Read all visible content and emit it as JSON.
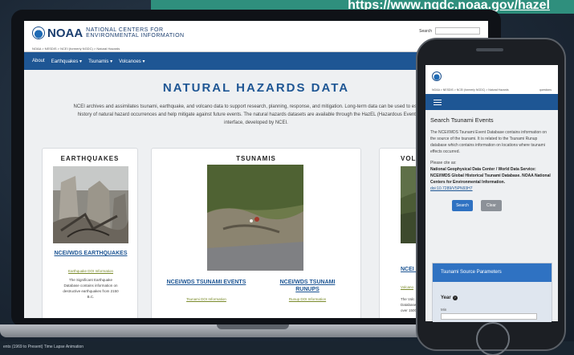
{
  "banner": {
    "url": "https://www.ngdc.noaa.gov/hazel"
  },
  "laptop": {
    "logo_text": "NOAA",
    "org_line1": "NATIONAL CENTERS FOR",
    "org_line2": "ENVIRONMENTAL INFORMATION",
    "search_label": "Search",
    "breadcrumb": "NOAA > NESDIS > NCEI (formerly NGDC) > Natural Hazards",
    "nav": [
      "About",
      "Earthquakes ▾",
      "Tsunamis ▾",
      "Volcanoes ▾"
    ],
    "page_title": "NATURAL HAZARDS DATA",
    "intro": "NCEI archives and assimilates tsunami, earthquake, and volcano data to support research, planning, response, and mitigation. Long-term data can be used to establish the history of natural hazard occurrences and help mitigate against future events. The natural hazards datasets are available through the HazEL (Hazardous Event Lookup) interface, developed by NCEI.",
    "cards": [
      {
        "title": "EARTHQUAKES",
        "link": "NCEI/WDS EARTHQUAKES",
        "sublink": "Earthquake DOI Information",
        "desc": "The Significant Earthquake Database contains information on destructive earthquakes from 2150 B.C."
      },
      {
        "title": "TSUNAMIS",
        "link1": "NCEI/WDS TSUNAMI EVENTS",
        "sublink1": "Tsunami DOI Information",
        "link2": "NCEI/WDS TSUNAMI RUNUPS",
        "sublink2": "Runup DOI Information"
      },
      {
        "title": "VOLC",
        "link": "NCEI LOC",
        "sublink": "Volcano",
        "desc": "The Volc Database in over 1500"
      }
    ]
  },
  "bottom_bar": {
    "text": "ents (1969 to Present) Time Lapse Animation"
  },
  "phone": {
    "breadcrumb": "NOAA > NESDIS > NCEI (formerly NGDC) > Natural Hazards",
    "breadcrumb_right": "questions",
    "heading": "Search Tsunami Events",
    "description": "The NCEI/WDS Tsunami Event Database contains information on the source of the tsunami. It is related to the Tsunami Runup database which contains information on locations where tsunami effects occurred.",
    "cite_label": "Please cite as:",
    "citation": "National Geophysical Data Center / World Data Service: NCEI/WDS Global Historical Tsunami Database. NOAA National Centers for Environmental Information.",
    "doi": "doi:10.7289/V5PN93H7",
    "search_button": "Search",
    "clear_button": "Clear",
    "panel_title": "Tsunami Source Parameters",
    "year_label": "Year",
    "help_glyph": "?",
    "min_label": "Min"
  }
}
